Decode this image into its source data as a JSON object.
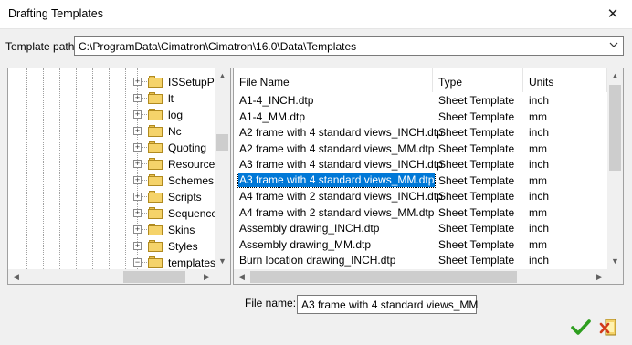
{
  "window": {
    "title": "Drafting Templates",
    "close_glyph": "✕"
  },
  "template_path": {
    "label": "Template path:",
    "value": "C:\\ProgramData\\Cimatron\\Cimatron\\16.0\\Data\\Templates"
  },
  "tree": {
    "items": [
      {
        "label": "ISSetupPr",
        "expander": "+"
      },
      {
        "label": "lt",
        "expander": "+"
      },
      {
        "label": "log",
        "expander": "+"
      },
      {
        "label": "Nc",
        "expander": "+"
      },
      {
        "label": "Quoting",
        "expander": "+"
      },
      {
        "label": "Resource",
        "expander": "+"
      },
      {
        "label": "Schemes",
        "expander": "+"
      },
      {
        "label": "Scripts",
        "expander": "+"
      },
      {
        "label": "Sequence",
        "expander": "+"
      },
      {
        "label": "Skins",
        "expander": "+"
      },
      {
        "label": "Styles",
        "expander": "+"
      },
      {
        "label": "templates",
        "expander": "−"
      }
    ]
  },
  "file_list": {
    "columns": [
      "File Name",
      "Type",
      "Units"
    ],
    "rows": [
      {
        "name": "A1-4_INCH.dtp",
        "type": "Sheet Template",
        "units": "inch"
      },
      {
        "name": "A1-4_MM.dtp",
        "type": "Sheet Template",
        "units": "mm"
      },
      {
        "name": "A2 frame with 4 standard views_INCH.dtp",
        "type": "Sheet Template",
        "units": "inch"
      },
      {
        "name": "A2 frame with 4 standard views_MM.dtp",
        "type": "Sheet Template",
        "units": "mm"
      },
      {
        "name": "A3 frame with 4 standard views_INCH.dtp",
        "type": "Sheet Template",
        "units": "inch"
      },
      {
        "name": "A3 frame with 4 standard views_MM.dtp",
        "type": "Sheet Template",
        "units": "mm",
        "selected": true
      },
      {
        "name": "A4 frame with 2 standard views_INCH.dtp",
        "type": "Sheet Template",
        "units": "inch"
      },
      {
        "name": "A4 frame with 2 standard views_MM.dtp",
        "type": "Sheet Template",
        "units": "mm"
      },
      {
        "name": "Assembly drawing_INCH.dtp",
        "type": "Sheet Template",
        "units": "inch"
      },
      {
        "name": "Assembly drawing_MM.dtp",
        "type": "Sheet Template",
        "units": "mm"
      },
      {
        "name": "Burn location drawing_INCH.dtp",
        "type": "Sheet Template",
        "units": "inch"
      }
    ]
  },
  "file_name": {
    "label": "File name:",
    "value": "A3 frame with 4 standard views_MM"
  },
  "icons": {
    "ok": "checkmark-icon",
    "cancel": "cancel-icon",
    "folder": "folder-icon"
  },
  "colors": {
    "selection": "#0078d7",
    "ok_green": "#2e9e1f",
    "folder_yellow": "#f5d36a",
    "cancel_red": "#d23a1a"
  }
}
